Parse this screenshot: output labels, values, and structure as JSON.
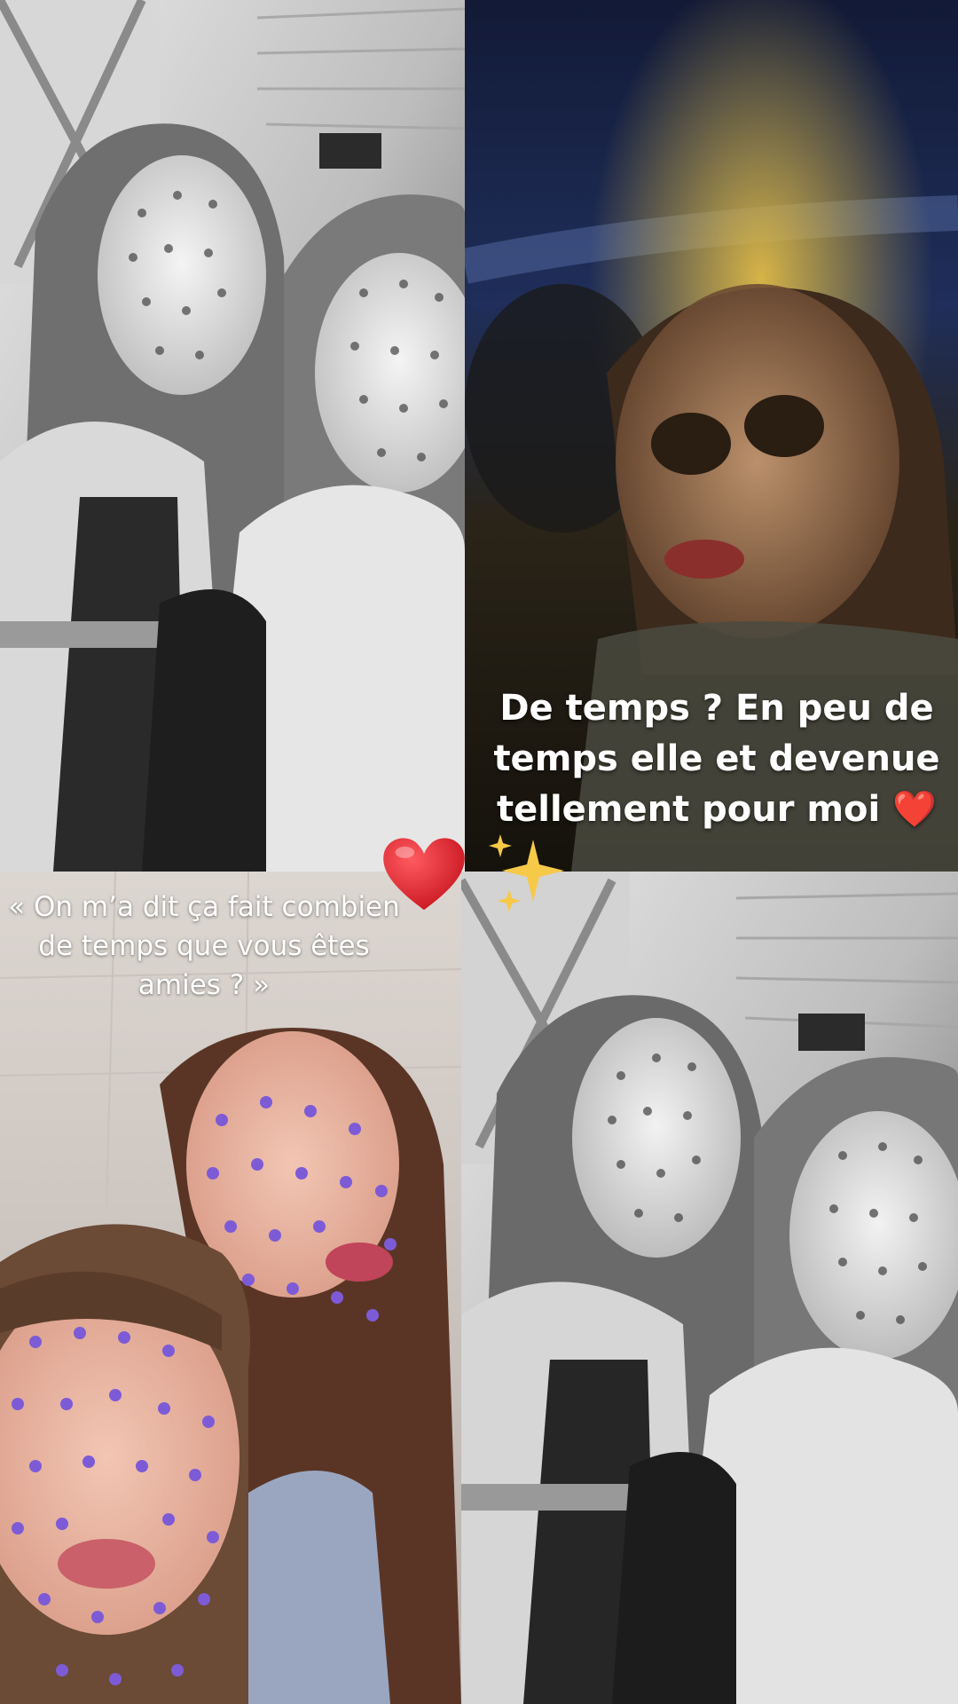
{
  "caption_night": {
    "text": "De temps ? En peu de temps elle et devenue tellement pour moi",
    "emoji": "❤️"
  },
  "caption_quote": {
    "text": "« On m’a dit ça fait combien de temps que vous êtes amies ? »"
  },
  "stickers": {
    "big_heart": "❤️",
    "sparkles": "✨"
  },
  "colors": {
    "heart": "#e0212a",
    "sparkle": "#f7c948",
    "filter_dots": "#7d5bd6"
  }
}
